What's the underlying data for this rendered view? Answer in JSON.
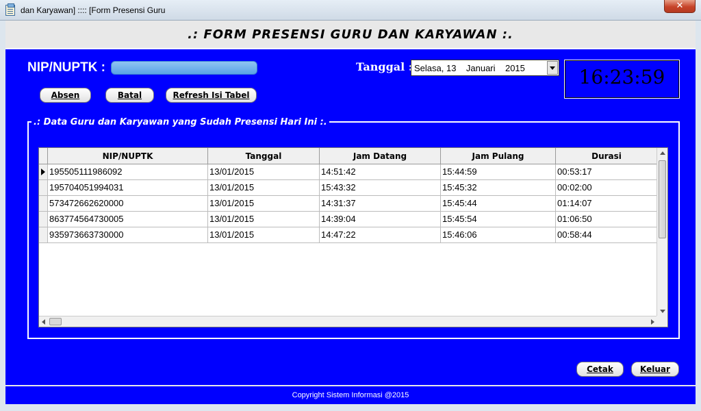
{
  "window": {
    "title": "dan Karyawan] :::: [Form Presensi Guru",
    "close_label": "✕"
  },
  "header": {
    "title": ".: FORM PRESENSI GURU DAN KARYAWAN :."
  },
  "nip": {
    "label": "NIP/NUPTK :",
    "value": ""
  },
  "tanggal": {
    "label": "Tanggal :",
    "value": "Selasa, 13    Januari    2015"
  },
  "clock": {
    "time": "16:23:59"
  },
  "buttons": {
    "absen": "Absen",
    "batal": "Batal",
    "refresh": "Refresh Isi Tabel",
    "cetak": "Cetak",
    "keluar": "Keluar"
  },
  "group": {
    "title": ".: Data Guru dan Karyawan yang Sudah Presensi Hari Ini :."
  },
  "table": {
    "columns": [
      "NIP/NUPTK",
      "Tanggal",
      "Jam Datang",
      "Jam Pulang",
      "Durasi"
    ],
    "rows": [
      [
        "195505111986092",
        "13/01/2015",
        "14:51:42",
        "15:44:59",
        "00:53:17"
      ],
      [
        "195704051994031",
        "13/01/2015",
        "15:43:32",
        "15:45:32",
        "00:02:00"
      ],
      [
        "573472662620000",
        "13/01/2015",
        "14:31:37",
        "15:45:44",
        "01:14:07"
      ],
      [
        "863774564730005",
        "13/01/2015",
        "14:39:04",
        "15:45:54",
        "01:06:50"
      ],
      [
        "935973663730000",
        "13/01/2015",
        "14:47:22",
        "15:46:06",
        "00:58:44"
      ]
    ]
  },
  "footer": {
    "text": "Copyright Sistem Informasi @2015"
  },
  "colors": {
    "form_bg": "#0000ff",
    "header_bg": "#e8e8e8",
    "input_bg": "#5aa3e6"
  }
}
